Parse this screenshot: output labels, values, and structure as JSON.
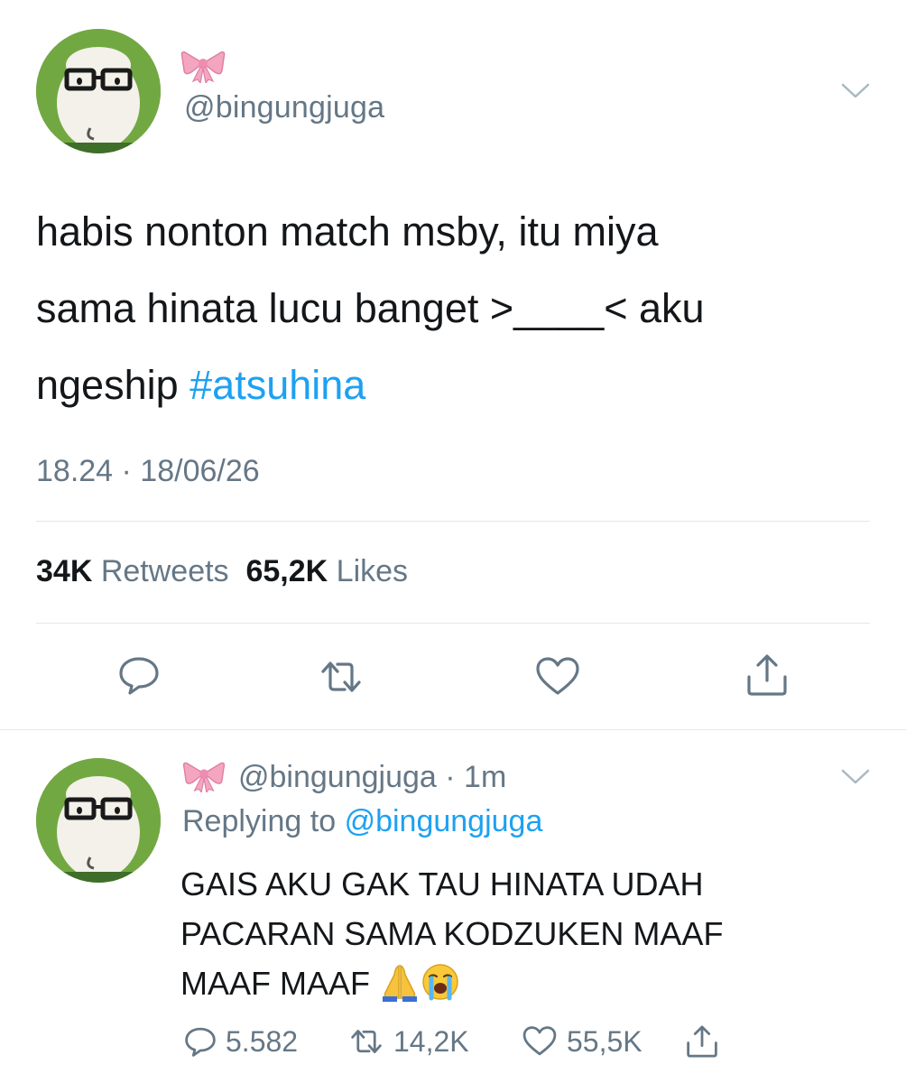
{
  "main_tweet": {
    "name_emoji": "🎀",
    "handle": "@bingungjuga",
    "text_before_hashtag": "habis nonton match msby, itu miya\nsama hinata lucu banget >____< aku\nngeship ",
    "hashtag": "#atsuhina",
    "timestamp": "18.24 · 18/06/26",
    "retweets_count": "34K",
    "retweets_label": "Retweets",
    "likes_count": "65,2K",
    "likes_label": "Likes",
    "actions": [
      "reply-icon",
      "retweet-icon",
      "like-icon",
      "share-icon"
    ]
  },
  "reply_tweet": {
    "name_emoji": "🎀",
    "handle": "@bingungjuga",
    "time": "· 1m",
    "replying_to_label": "Replying to",
    "replying_to_handle": "@bingungjuga",
    "text": "GAIS AKU GAK TAU HINATA UDAH\nPACARAN SAMA KODZUKEN MAAF\nMAAF MAAF ",
    "emojis": [
      "folded-hands-icon",
      "loudly-crying-face-icon"
    ],
    "reply_count": "5.582",
    "retweet_count": "14,2K",
    "like_count": "55,5K"
  },
  "colors": {
    "text": "#14171a",
    "secondary": "#657786",
    "link": "#1da1f2",
    "divider": "#e1e8ed",
    "bow": "#f4a6c0",
    "avatar_bg": "#6fa63c"
  }
}
